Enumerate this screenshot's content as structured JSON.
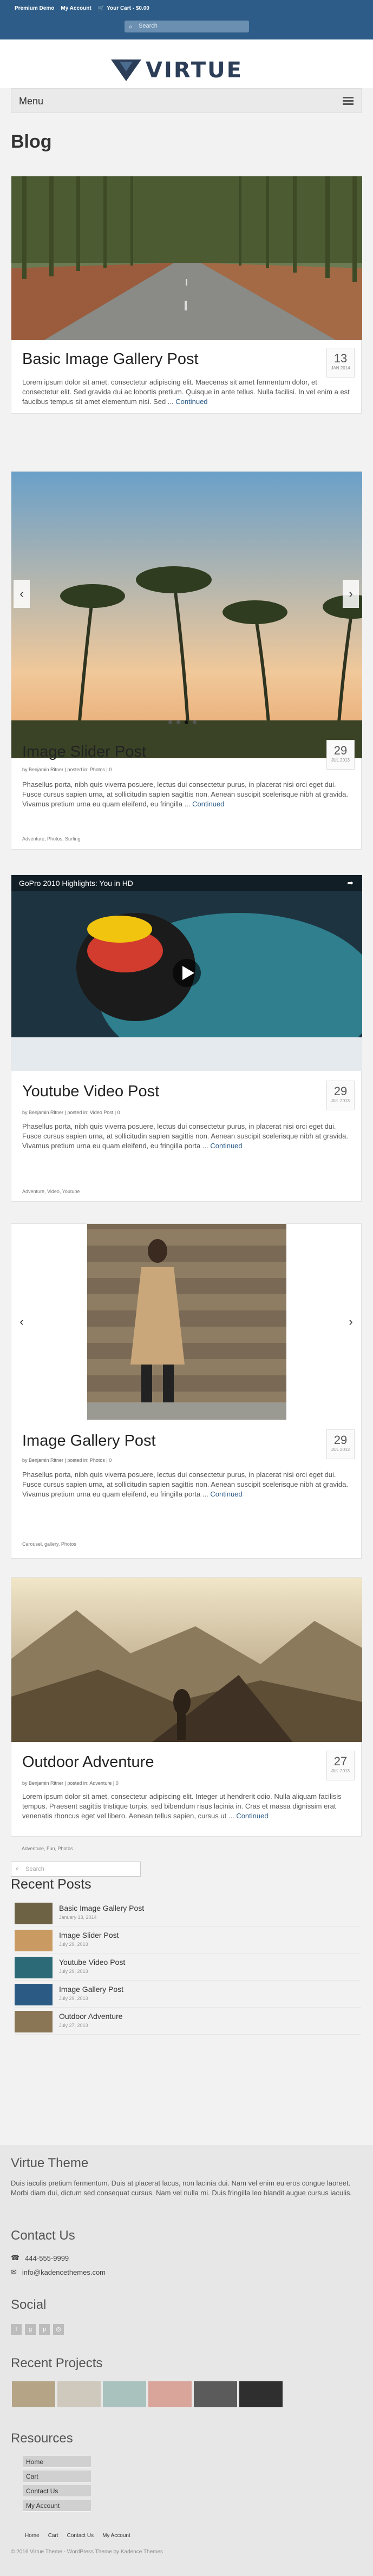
{
  "topbar": {
    "links": [
      "Premium Demo",
      "My Account",
      "Your Cart - $0.00"
    ],
    "search_placeholder": "Search"
  },
  "header": {
    "logo_text": "VIRTUE",
    "menu_label": "Menu"
  },
  "page": {
    "title": "Blog"
  },
  "posts": [
    {
      "title": "Basic Image Gallery Post",
      "day": "13",
      "month": "JAN 2014",
      "meta": "",
      "excerpt": "Lorem ipsum dolor sit amet, consectetur adipiscing elit. Maecenas sit amet fermentum dolor, et consectetur elit. Sed gravida dui ac lobortis pretium. Quisque in ante tellus. Nulla facilisi. In vel enim a est faucibus tempus sit amet elementum nisi. Sed ...",
      "more": "Continued",
      "tags": ""
    },
    {
      "title": "Image Slider Post",
      "day": "29",
      "month": "JUL 2013",
      "meta": "by Benjamin Ritner | posted in: Photos | 0",
      "excerpt": "Phasellus porta, nibh quis viverra posuere, lectus dui consectetur purus, in placerat nisi orci eget dui. Fusce cursus sapien urna, at sollicitudin sapien sagittis non. Aenean suscipit scelerisque nibh at gravida. Vivamus pretium urna eu quam eleifend, eu fringilla ...",
      "more": "Continued",
      "tags": "Adventure, Photos, Surfing"
    },
    {
      "title": "Youtube Video Post",
      "day": "29",
      "month": "JUL 2013",
      "meta": "by Benjamin Ritner | posted in: Video Post | 0",
      "excerpt": "Phasellus porta, nibh quis viverra posuere, lectus dui consectetur purus, in placerat nisi orci eget dui. Fusce cursus sapien urna, at sollicitudin sapien sagittis non. Aenean suscipit scelerisque nibh at gravida. Vivamus pretium urna eu quam eleifend, eu fringilla porta ...",
      "more": "Continued",
      "tags": "Adventure, Video, Youtube"
    },
    {
      "title": "Image Gallery Post",
      "day": "29",
      "month": "JUL 2013",
      "meta": "by Benjamin Ritner | posted in: Photos | 0",
      "excerpt": "Phasellus porta, nibh quis viverra posuere, lectus dui consectetur purus, in placerat nisi orci eget dui. Fusce cursus sapien urna, at sollicitudin sapien sagittis non. Aenean suscipit scelerisque nibh at gravida. Vivamus pretium urna eu quam eleifend, eu fringilla porta ...",
      "more": "Continued",
      "tags": "Carousel, gallery, Photos"
    },
    {
      "title": "Outdoor Adventure",
      "day": "27",
      "month": "JUL 2013",
      "meta": "by Benjamin Ritner | posted in: Adventure | 0",
      "excerpt": "Lorem ipsum dolor sit amet, consectetur adipiscing elit. Integer ut hendrerit odio. Nulla aliquam facilisis tempus. Praesent sagittis tristique turpis, sed bibendum risus lacinia in. Cras et massa dignissim erat venenatis rhoncus eget vel libero. Aenean tellus sapien, cursus ut ...",
      "more": "Continued",
      "tags": "Adventure, Fun, Photos"
    }
  ],
  "video": {
    "title": "GoPro 2010 Highlights: You in HD"
  },
  "sidebar": {
    "search_placeholder": "Search",
    "recent_title": "Recent Posts",
    "recent": [
      {
        "title": "Basic Image Gallery Post",
        "date": "January 13, 2014"
      },
      {
        "title": "Image Slider Post",
        "date": "July 29, 2013"
      },
      {
        "title": "Youtube Video Post",
        "date": "July 29, 2013"
      },
      {
        "title": "Image Gallery Post",
        "date": "July 29, 2013"
      },
      {
        "title": "Outdoor Adventure",
        "date": "July 27, 2013"
      }
    ]
  },
  "footer": {
    "about_title": "Virtue Theme",
    "about_text": "Duis iaculis pretium fermentum. Duis at placerat lacus, non lacinia dui. Nam vel enim eu eros congue laoreet. Morbi diam dui, dictum sed consequat cursus. Nam vel nulla mi. Duis fringilla leo blandit augue cursus iaculis.",
    "contact_title": "Contact Us",
    "phone": "444-555-9999",
    "email": "info@kadencethemes.com",
    "social_title": "Social",
    "projects_title": "Recent Projects",
    "resources_title": "Resources",
    "resources": [
      "Home",
      "Cart",
      "Contact Us",
      "My Account"
    ],
    "bottom_links": [
      "Home",
      "Cart",
      "Contact Us",
      "My Account"
    ],
    "copyright": "© 2016 Virtue Theme - WordPress Theme by Kadence Themes"
  },
  "colors": {
    "brand": "#2d5c88",
    "link": "#2d5c88"
  }
}
